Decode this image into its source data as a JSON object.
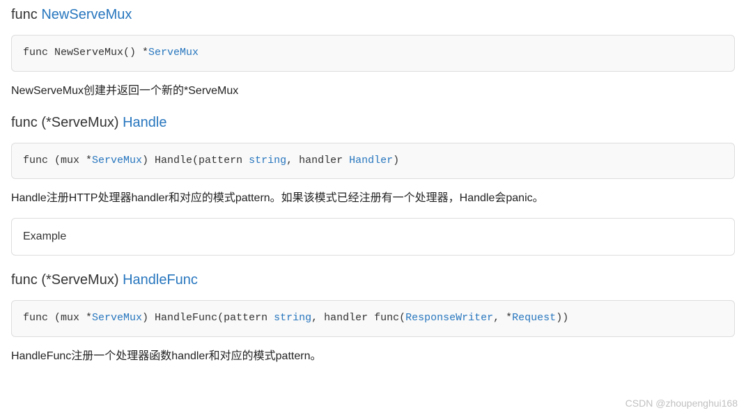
{
  "sections": [
    {
      "heading_prefix": "func ",
      "heading_link": "NewServeMux",
      "code": {
        "t1": "func NewServeMux() *",
        "l1": "ServeMux"
      },
      "desc": "NewServeMux创建并返回一个新的*ServeMux"
    },
    {
      "heading_prefix": "func (*ServeMux) ",
      "heading_link": "Handle",
      "code": {
        "t1": "func (mux *",
        "l1": "ServeMux",
        "t2": ") Handle(pattern ",
        "k1": "string",
        "t3": ", handler ",
        "l2": "Handler",
        "t4": ")"
      },
      "desc": "Handle注册HTTP处理器handler和对应的模式pattern。如果该模式已经注册有一个处理器，Handle会panic。",
      "example_label": "Example"
    },
    {
      "heading_prefix": "func (*ServeMux) ",
      "heading_link": "HandleFunc",
      "code": {
        "t1": "func (mux *",
        "l1": "ServeMux",
        "t2": ") HandleFunc(pattern ",
        "k1": "string",
        "t3": ", handler func(",
        "l2": "ResponseWriter",
        "t4": ", *",
        "l3": "Request",
        "t5": "))"
      },
      "desc": "HandleFunc注册一个处理器函数handler和对应的模式pattern。"
    }
  ],
  "watermark": "CSDN @zhoupenghui168"
}
